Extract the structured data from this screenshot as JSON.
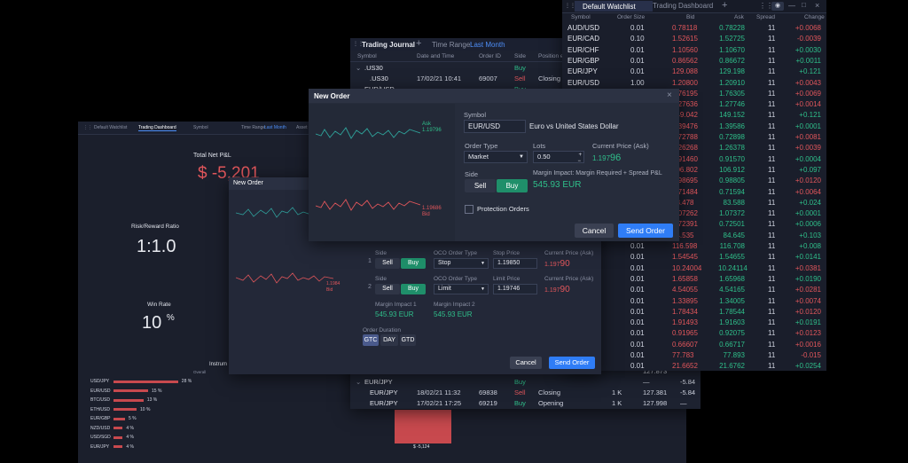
{
  "watchlist": {
    "tabs": [
      "Default Watchlist",
      "Trading Dashboard"
    ],
    "add_tab": "+",
    "columns": [
      "Symbol",
      "Order Size",
      "Bid",
      "Ask",
      "Spread",
      "Change"
    ],
    "rows": [
      {
        "symbol": "AUD/USD",
        "size": "0.01",
        "bid": "0.78118",
        "ask": "0.78228",
        "spread": "11",
        "change": "+0.0068",
        "up": false
      },
      {
        "symbol": "EUR/CAD",
        "size": "0.10",
        "bid": "1.52615",
        "ask": "1.52725",
        "spread": "11",
        "change": "-0.0039",
        "up": false
      },
      {
        "symbol": "EUR/CHF",
        "size": "0.01",
        "bid": "1.10560",
        "ask": "1.10670",
        "spread": "11",
        "change": "+0.0030",
        "up": true
      },
      {
        "symbol": "EUR/GBP",
        "size": "0.01",
        "bid": "0.86562",
        "ask": "0.86672",
        "spread": "11",
        "change": "+0.0011",
        "up": true
      },
      {
        "symbol": "EUR/JPY",
        "size": "0.01",
        "bid": "129.088",
        "ask": "129.198",
        "spread": "11",
        "change": "+0.121",
        "up": true
      },
      {
        "symbol": "EUR/USD",
        "size": "1.00",
        "bid": "1.20800",
        "ask": "1.20910",
        "spread": "11",
        "change": "+0.0043",
        "up": false
      },
      {
        "symbol": "",
        "size": "",
        "bid": "1.76195",
        "ask": "1.76305",
        "spread": "11",
        "change": "+0.0069",
        "up": false
      },
      {
        "symbol": "",
        "size": "",
        "bid": "1.27636",
        "ask": "1.27746",
        "spread": "11",
        "change": "+0.0014",
        "up": false
      },
      {
        "symbol": "",
        "size": "",
        "bid": "149.042",
        "ask": "149.152",
        "spread": "11",
        "change": "+0.121",
        "up": true
      },
      {
        "symbol": "",
        "size": "",
        "bid": "1.39476",
        "ask": "1.39586",
        "spread": "11",
        "change": "+0.0001",
        "up": true
      },
      {
        "symbol": "",
        "size": "",
        "bid": "0.72788",
        "ask": "0.72898",
        "spread": "11",
        "change": "+0.0081",
        "up": false
      },
      {
        "symbol": "",
        "size": "",
        "bid": "1.26268",
        "ask": "1.26378",
        "spread": "11",
        "change": "+0.0039",
        "up": false
      },
      {
        "symbol": "",
        "size": "",
        "bid": "0.91460",
        "ask": "0.91570",
        "spread": "11",
        "change": "+0.0004",
        "up": true
      },
      {
        "symbol": "",
        "size": "",
        "bid": "106.802",
        "ask": "106.912",
        "spread": "11",
        "change": "+0.097",
        "up": true
      },
      {
        "symbol": "",
        "size": "",
        "bid": "0.98695",
        "ask": "0.98805",
        "spread": "11",
        "change": "+0.0120",
        "up": false
      },
      {
        "symbol": "",
        "size": "",
        "bid": "0.71484",
        "ask": "0.71594",
        "spread": "11",
        "change": "+0.0064",
        "up": false
      },
      {
        "symbol": "",
        "size": "",
        "bid": "83.478",
        "ask": "83.588",
        "spread": "11",
        "change": "+0.024",
        "up": true
      },
      {
        "symbol": "",
        "size": "",
        "bid": "1.07262",
        "ask": "1.07372",
        "spread": "11",
        "change": "+0.0001",
        "up": true
      },
      {
        "symbol": "",
        "size": "",
        "bid": "0.72391",
        "ask": "0.72501",
        "spread": "11",
        "change": "+0.0006",
        "up": true
      },
      {
        "symbol": "",
        "size": "",
        "bid": "84.535",
        "ask": "84.645",
        "spread": "11",
        "change": "+0.103",
        "up": true
      },
      {
        "symbol": "",
        "size": "0.01",
        "bid": "116.598",
        "ask": "116.708",
        "spread": "11",
        "change": "+0.008",
        "up": true
      },
      {
        "symbol": "",
        "size": "0.01",
        "bid": "1.54545",
        "ask": "1.54655",
        "spread": "11",
        "change": "+0.0141",
        "up": true
      },
      {
        "symbol": "",
        "size": "0.01",
        "bid": "10.24004",
        "ask": "10.24114",
        "spread": "11",
        "change": "+0.0381",
        "up": false
      },
      {
        "symbol": "",
        "size": "0.01",
        "bid": "1.65858",
        "ask": "1.65968",
        "spread": "11",
        "change": "+0.0190",
        "up": true
      },
      {
        "symbol": "",
        "size": "0.01",
        "bid": "4.54055",
        "ask": "4.54165",
        "spread": "11",
        "change": "+0.0281",
        "up": false
      },
      {
        "symbol": "",
        "size": "0.01",
        "bid": "1.33895",
        "ask": "1.34005",
        "spread": "11",
        "change": "+0.0074",
        "up": false
      },
      {
        "symbol": "",
        "size": "0.01",
        "bid": "1.78434",
        "ask": "1.78544",
        "spread": "11",
        "change": "+0.0120",
        "up": false
      },
      {
        "symbol": "",
        "size": "0.01",
        "bid": "1.91493",
        "ask": "1.91603",
        "spread": "11",
        "change": "+0.0191",
        "up": true
      },
      {
        "symbol": "",
        "size": "0.01",
        "bid": "0.91965",
        "ask": "0.92075",
        "spread": "11",
        "change": "+0.0123",
        "up": false
      },
      {
        "symbol": "",
        "size": "0.01",
        "bid": "0.66607",
        "ask": "0.66717",
        "spread": "11",
        "change": "+0.0016",
        "up": false
      },
      {
        "symbol": "",
        "size": "0.01",
        "bid": "77.783",
        "ask": "77.893",
        "spread": "11",
        "change": "-0.015",
        "up": false
      },
      {
        "symbol": "",
        "size": "0.01",
        "bid": "21.6652",
        "ask": "21.6762",
        "spread": "11",
        "change": "+0.0254",
        "up": true
      }
    ]
  },
  "journal": {
    "title": "Trading Journal",
    "time_range_label": "Time Range:",
    "time_range_value": "Last Month",
    "columns": [
      "Symbol",
      "Date and Time",
      "Order ID",
      "Side",
      "Position eff"
    ],
    "rows_top": [
      {
        "symbol": ".US30",
        "date": "",
        "id": "",
        "side": "Buy",
        "effect": "",
        "qty": "",
        "price": "",
        "pnl": "",
        "group": true
      },
      {
        "symbol": ".US30",
        "date": "17/02/21 10:41",
        "id": "69007",
        "side": "Sell",
        "effect": "Closing",
        "qty": "",
        "price": "",
        "pnl": "",
        "group": false
      },
      {
        "symbol": "EUR/USD",
        "date": "",
        "id": "",
        "side": "Buy",
        "effect": "",
        "qty": "",
        "price": "",
        "pnl": "",
        "group": true
      }
    ],
    "rows_bottom": [
      {
        "symbol": "",
        "date": "17/02/21 12:57",
        "id": "",
        "side": "",
        "effect": "",
        "qty": "",
        "price": "127.873",
        "pnl": "",
        "group": false
      },
      {
        "symbol": "EUR/JPY",
        "date": "",
        "id": "",
        "side": "Buy",
        "effect": "",
        "qty": "",
        "price": "—",
        "pnl": "-5.84",
        "group": true
      },
      {
        "symbol": "EUR/JPY",
        "date": "18/02/21 11:32",
        "id": "69838",
        "side": "Sell",
        "effect": "Closing",
        "qty": "1 K",
        "price": "127.381",
        "pnl": "-5.84",
        "group": false
      },
      {
        "symbol": "EUR/JPY",
        "date": "17/02/21 17:25",
        "id": "69219",
        "side": "Buy",
        "effect": "Opening",
        "qty": "1 K",
        "price": "127.998",
        "pnl": "—",
        "group": false
      }
    ]
  },
  "dashboard": {
    "tabs": [
      "Default Watchlist",
      "Trading Dashboard"
    ],
    "symbol_label": "Symbol",
    "time_range_label": "Time Range:",
    "time_range_value": "Last Month",
    "asset_label": "Asset",
    "total_pnl_label": "Total Net P&L",
    "total_pnl_value": "$ -5,201",
    "rr_label": "Risk/Reward Ratio",
    "rr_value": "1:1.0",
    "win_label": "Win Rate",
    "win_value": "10",
    "win_unit": "%",
    "instrument_label": "Instrum",
    "overall_label": "Overall",
    "bar_value_label": "$ -5,124",
    "instruments": [
      {
        "name": "USD/JPY",
        "pct": "28 %",
        "w": 28
      },
      {
        "name": "EUR/USD",
        "pct": "15 %",
        "w": 15
      },
      {
        "name": "BTC/USD",
        "pct": "13 %",
        "w": 13
      },
      {
        "name": "ETH/USD",
        "pct": "10 %",
        "w": 10
      },
      {
        "name": "EUR/GBP",
        "pct": "5 %",
        "w": 5
      },
      {
        "name": "NZD/USD",
        "pct": "4 %",
        "w": 4
      },
      {
        "name": "USD/SGD",
        "pct": "4 %",
        "w": 4
      },
      {
        "name": "EUR/JPY",
        "pct": "4 %",
        "w": 4
      }
    ]
  },
  "order_small": {
    "title": "New Order",
    "spark_low_label": "1.1984",
    "spark_low_sub": "Bid",
    "legs": [
      {
        "num": "1",
        "side_label": "Side",
        "sell": "Sell",
        "buy": "Buy",
        "oco_label": "OCO Order Type",
        "oco_value": "Stop",
        "price_label": "Stop Price",
        "price_value": "1.19850",
        "current_label": "Current Price (Ask)",
        "current_prefix": "1.197",
        "current_big": "90"
      },
      {
        "num": "2",
        "side_label": "Side",
        "sell": "Sell",
        "buy": "Buy",
        "oco_label": "OCO Order Type",
        "oco_value": "Limit",
        "price_label": "Limit Price",
        "price_value": "1.19746",
        "current_label": "Current Price (Ask)",
        "current_prefix": "1.197",
        "current_big": "90"
      }
    ],
    "margin1_label": "Margin Impact 1",
    "margin1_value": "545.93 EUR",
    "margin2_label": "Margin Impact 2",
    "margin2_value": "545.93 EUR",
    "duration_label": "Order Duration",
    "durations": [
      "GTC",
      "DAY",
      "GTD"
    ],
    "cancel": "Cancel",
    "send": "Send Order"
  },
  "order_main": {
    "title": "New Order",
    "ask_label": "Ask",
    "ask_value": "1.19796",
    "bid_label": "Bid",
    "bid_value": "1.19686",
    "symbol_label": "Symbol",
    "symbol_value": "EUR/USD",
    "symbol_desc": "Euro vs United States Dollar",
    "order_type_label": "Order Type",
    "order_type_value": "Market",
    "lots_label": "Lots",
    "lots_value": "0.50",
    "current_label": "Current Price (Ask)",
    "current_prefix": "1.197",
    "current_big": "96",
    "side_label": "Side",
    "sell": "Sell",
    "buy": "Buy",
    "margin_label": "Margin Impact: Margin Required + Spread P&L",
    "margin_value": "545.93 EUR",
    "protection_label": "Protection Orders",
    "cancel": "Cancel",
    "send": "Send Order"
  },
  "colors": {
    "accent": "#2f7df6",
    "buy": "#1f8f6a",
    "sell": "#e0565b",
    "bg": "#1a1e2b"
  }
}
